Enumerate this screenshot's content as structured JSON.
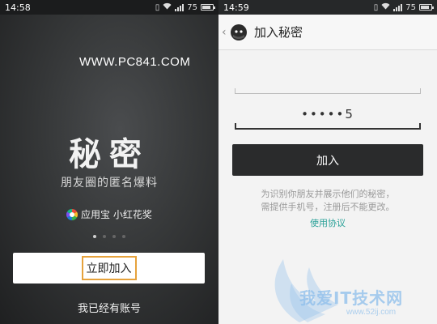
{
  "left_screen": {
    "status": {
      "time": "14:58",
      "battery": "75"
    },
    "watermark_url": "WWW.PC841.COM",
    "title": "秘密",
    "subtitle": "朋友圈的匿名爆料",
    "award_text": "应用宝 小红花奖",
    "join_button": "立即加入",
    "have_account_link": "我已经有账号"
  },
  "right_screen": {
    "status": {
      "time": "14:59",
      "battery": "75"
    },
    "header_title": "加入秘密",
    "field1_value": "",
    "field2_value": "•••••5",
    "submit_button": "加入",
    "hint_line1": "为识别你朋友并展示他们的秘密，",
    "hint_line2": "需提供手机号，注册后不能更改。",
    "terms_link": "使用协议",
    "watermark_text": "我爱IT技术网",
    "watermark_url": "www.52ij.com"
  },
  "colors": {
    "highlight_border": "#e6a23c",
    "link": "#2aa198",
    "button_dark": "#2a2b2c"
  }
}
